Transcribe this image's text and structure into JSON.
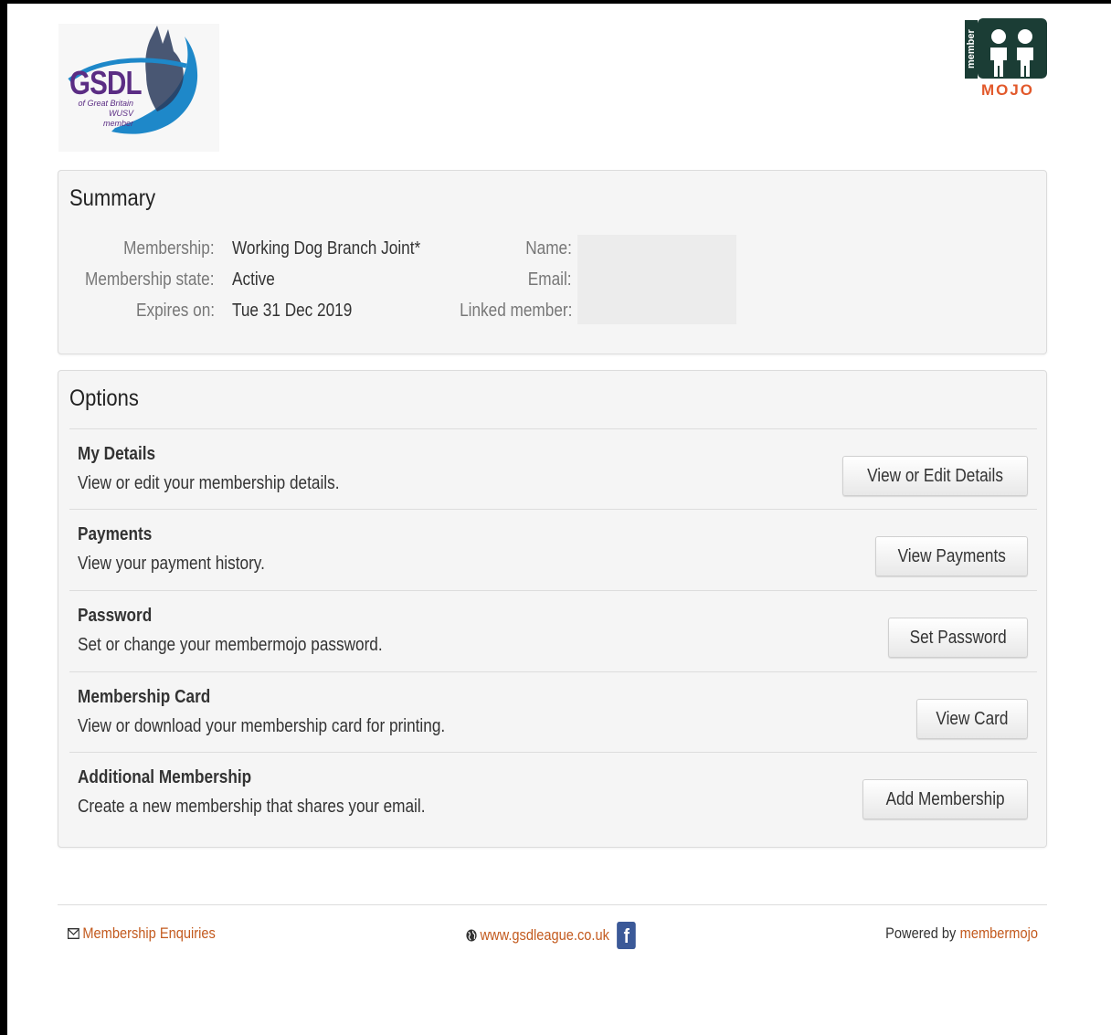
{
  "header": {
    "org_logo": {
      "icon": "gsdl-dog-logo",
      "text": "GSDL",
      "subtext_line1": "of Great Britain",
      "subtext_line2": "WUSV member"
    },
    "platform_logo": {
      "icon": "membermojo-logo",
      "side_text": "member",
      "word": "MOJO"
    }
  },
  "summary": {
    "title": "Summary",
    "left_fields": [
      {
        "label": "Membership:",
        "value": "Working Dog Branch Joint*"
      },
      {
        "label": "Membership state:",
        "value": "Active"
      },
      {
        "label": "Expires on:",
        "value": "Tue 31 Dec 2019"
      }
    ],
    "right_fields": [
      {
        "label": "Name:"
      },
      {
        "label": "Email:"
      },
      {
        "label": "Linked member:"
      }
    ]
  },
  "options": {
    "title": "Options",
    "items": [
      {
        "title": "My Details",
        "description": "View or edit your membership details.",
        "button": "View or Edit Details"
      },
      {
        "title": "Payments",
        "description": "View your payment history.",
        "button": "View Payments"
      },
      {
        "title": "Password",
        "description": "Set or change your membermojo password.",
        "button": "Set Password"
      },
      {
        "title": "Membership Card",
        "description": "View or download your membership card for printing.",
        "button": "View Card"
      },
      {
        "title": "Additional Membership",
        "description": "Create a new membership that shares your email.",
        "button": "Add Membership"
      }
    ]
  },
  "footer": {
    "enquiries": {
      "icon": "envelope-icon",
      "label": "Membership Enquiries"
    },
    "website": {
      "icon": "globe-icon",
      "label": "www.gsdleague.co.uk",
      "social_icon": "facebook-icon"
    },
    "powered": {
      "prefix": "Powered by",
      "link": "membermojo"
    }
  },
  "colors": {
    "link": "#c35a1e",
    "panel_bg": "#f5f5f5",
    "brand_purple": "#5b2d84",
    "brand_blue": "#1e88c9",
    "mojo_orange": "#e2592b",
    "mojo_green": "#1b3d35",
    "facebook_blue": "#3b5998"
  }
}
